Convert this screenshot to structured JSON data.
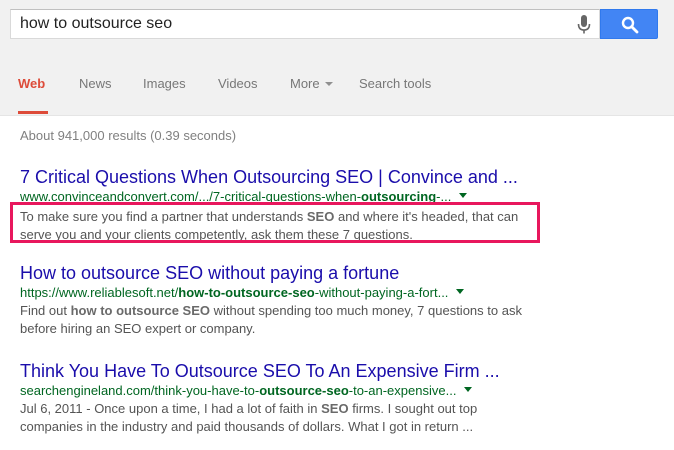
{
  "search": {
    "query": "how to outsource seo",
    "mic_icon": "microphone-icon",
    "button_icon": "search-icon",
    "button_color": "#4285f4"
  },
  "tabs": [
    {
      "label": "Web",
      "active": true
    },
    {
      "label": "News"
    },
    {
      "label": "Images"
    },
    {
      "label": "Videos"
    },
    {
      "label": "More"
    },
    {
      "label": "Search tools"
    }
  ],
  "stats": "About 941,000 results (0.39 seconds)",
  "results": [
    {
      "title": "7 Critical Questions When Outsourcing SEO | Convince and ...",
      "url_parts": [
        "www.convinceandconvert.com/.../7-critical-questions-when-",
        "outsourcing",
        "-..."
      ],
      "snippet_parts": [
        "To make sure you find a partner that understands ",
        "SEO",
        " and where it's headed, that can serve you and your clients competently, ask them these 7 questions."
      ]
    },
    {
      "title": "How to outsource SEO without paying a fortune",
      "url_parts": [
        "https://www.reliablesoft.net/",
        "how-to-outsource-seo",
        "-without-paying-a-fort..."
      ],
      "snippet_parts": [
        "Find out ",
        "how to outsource SEO",
        " without spending too much money, 7 questions to ask before hiring an SEO expert or company."
      ]
    },
    {
      "title": "Think You Have To Outsource SEO To An Expensive Firm ...",
      "url_parts": [
        "searchengineland.com/think-you-have-to-",
        "outsource-seo",
        "-to-an-expensive..."
      ],
      "snippet_parts": [
        "Jul 6, 2011 - Once upon a time, I had a lot of faith in ",
        "SEO",
        " firms. I sought out top companies in the industry and paid thousands of dollars. What I got in return ..."
      ]
    }
  ],
  "colors": {
    "accent_red": "#dd4b39",
    "link_blue": "#1a0dab",
    "url_green": "#006621",
    "highlight_pink": "#e8175d"
  }
}
